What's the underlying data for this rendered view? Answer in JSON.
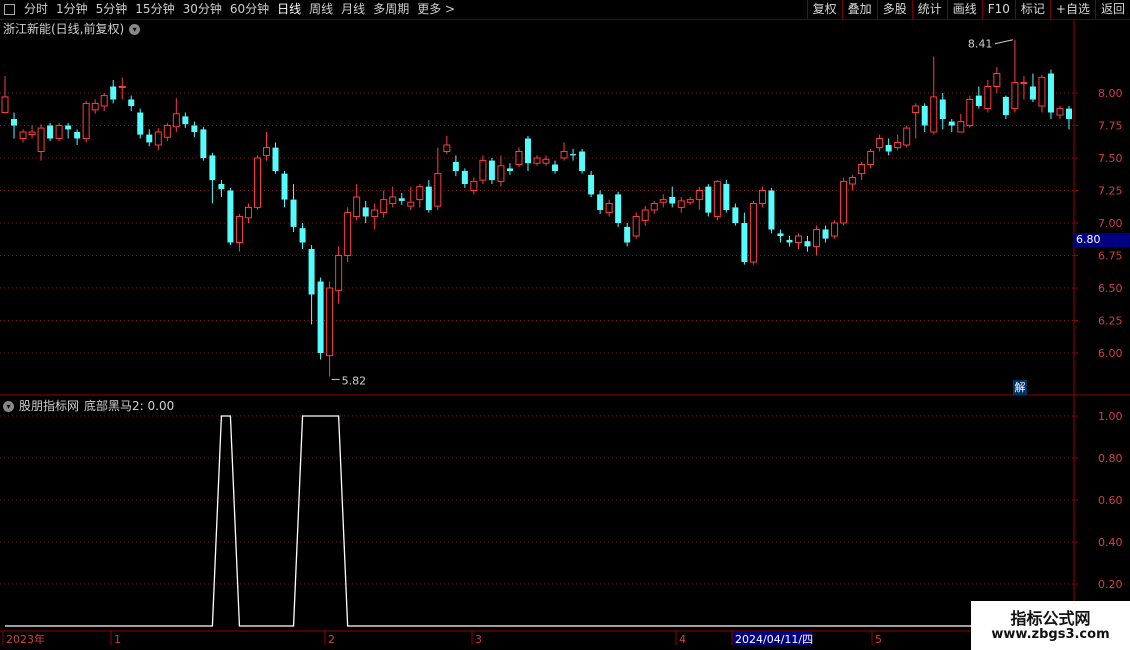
{
  "toolbar": {
    "periods": [
      "分时",
      "1分钟",
      "5分钟",
      "15分钟",
      "30分钟",
      "60分钟",
      "日线",
      "周线",
      "月线",
      "多周期",
      "更多 >"
    ],
    "active_period": "日线",
    "buttons": [
      "复权",
      "叠加",
      "多股",
      "统计",
      "画线",
      "F10",
      "标记",
      "+自选",
      "返回"
    ]
  },
  "main_chart": {
    "title": "浙江新能(日线,前复权)",
    "high_label": "8.41",
    "low_label": "5.82",
    "current_price": "6.80",
    "jie_label": "解",
    "y_ticks": [
      "8.00",
      "7.75",
      "7.50",
      "7.25",
      "7.00",
      "6.75",
      "6.50",
      "6.25",
      "6.00"
    ],
    "up_color": "#ff3c3c",
    "down_color": "#54fcfc"
  },
  "indicator": {
    "title": "股朋指标网",
    "label": "底部黑马2: 0.00",
    "y_ticks": [
      "1.00",
      "0.80",
      "0.60",
      "0.40",
      "0.20"
    ]
  },
  "x_axis": {
    "labels": [
      "2023年",
      "1",
      "2",
      "3",
      "4",
      "2024/04/11/四",
      "5"
    ]
  },
  "watermark": {
    "line1": "指标公式网",
    "line2": "www.zbgs3.com"
  },
  "chart_data": {
    "type": "candlestick",
    "candles": [
      [
        7.85,
        7.97,
        8.13,
        7.9
      ],
      [
        7.8,
        7.75,
        7.85,
        7.65
      ],
      [
        7.65,
        7.7,
        7.72,
        7.62
      ],
      [
        7.68,
        7.7,
        7.75,
        7.65
      ],
      [
        7.55,
        7.73,
        7.76,
        7.48
      ],
      [
        7.75,
        7.65,
        7.77,
        7.63
      ],
      [
        7.65,
        7.75,
        7.77,
        7.63
      ],
      [
        7.75,
        7.72,
        7.77,
        7.65
      ],
      [
        7.7,
        7.65,
        7.72,
        7.6
      ],
      [
        7.65,
        7.92,
        7.94,
        7.62
      ],
      [
        7.87,
        7.92,
        7.95,
        7.84
      ],
      [
        7.9,
        7.98,
        8.0,
        7.86
      ],
      [
        8.05,
        7.95,
        8.1,
        7.92
      ],
      [
        8.05,
        8.05,
        8.12,
        7.95
      ],
      [
        7.95,
        7.9,
        7.98,
        7.86
      ],
      [
        7.85,
        7.68,
        7.88,
        7.65
      ],
      [
        7.68,
        7.62,
        7.72,
        7.59
      ],
      [
        7.6,
        7.7,
        7.73,
        7.56
      ],
      [
        7.66,
        7.75,
        7.77,
        7.63
      ],
      [
        7.74,
        7.84,
        7.96,
        7.7
      ],
      [
        7.82,
        7.76,
        7.85,
        7.73
      ],
      [
        7.75,
        7.7,
        7.78,
        7.66
      ],
      [
        7.72,
        7.5,
        7.74,
        7.48
      ],
      [
        7.52,
        7.33,
        7.54,
        7.15
      ],
      [
        7.3,
        7.26,
        7.33,
        7.2
      ],
      [
        7.25,
        6.85,
        7.27,
        6.83
      ],
      [
        6.85,
        7.05,
        7.07,
        6.78
      ],
      [
        7.04,
        7.12,
        7.15,
        7.0
      ],
      [
        7.12,
        7.5,
        7.52,
        7.1
      ],
      [
        7.52,
        7.58,
        7.7,
        7.48
      ],
      [
        7.58,
        7.4,
        7.62,
        7.38
      ],
      [
        7.38,
        7.18,
        7.4,
        7.12
      ],
      [
        7.18,
        6.97,
        7.3,
        6.93
      ],
      [
        6.96,
        6.85,
        7.0,
        6.8
      ],
      [
        6.8,
        6.45,
        6.83,
        6.22
      ],
      [
        6.55,
        6.0,
        6.58,
        5.95
      ],
      [
        5.98,
        6.5,
        6.55,
        5.82
      ],
      [
        6.48,
        6.75,
        6.82,
        6.38
      ],
      [
        6.75,
        7.08,
        7.12,
        6.7
      ],
      [
        7.05,
        7.2,
        7.3,
        7.02
      ],
      [
        7.12,
        7.05,
        7.17,
        7.0
      ],
      [
        7.05,
        7.1,
        7.15,
        6.95
      ],
      [
        7.08,
        7.18,
        7.25,
        7.04
      ],
      [
        7.15,
        7.2,
        7.28,
        7.12
      ],
      [
        7.19,
        7.17,
        7.23,
        7.14
      ],
      [
        7.13,
        7.16,
        7.28,
        7.1
      ],
      [
        7.18,
        7.28,
        7.3,
        7.12
      ],
      [
        7.28,
        7.1,
        7.33,
        7.08
      ],
      [
        7.13,
        7.38,
        7.58,
        7.1
      ],
      [
        7.55,
        7.6,
        7.67,
        7.53
      ],
      [
        7.47,
        7.4,
        7.52,
        7.36
      ],
      [
        7.4,
        7.3,
        7.42,
        7.27
      ],
      [
        7.25,
        7.32,
        7.35,
        7.22
      ],
      [
        7.33,
        7.48,
        7.52,
        7.3
      ],
      [
        7.48,
        7.33,
        7.5,
        7.3
      ],
      [
        7.32,
        7.44,
        7.52,
        7.28
      ],
      [
        7.42,
        7.4,
        7.46,
        7.37
      ],
      [
        7.45,
        7.55,
        7.58,
        7.43
      ],
      [
        7.65,
        7.46,
        7.67,
        7.4
      ],
      [
        7.46,
        7.5,
        7.52,
        7.44
      ],
      [
        7.46,
        7.49,
        7.52,
        7.44
      ],
      [
        7.45,
        7.4,
        7.48,
        7.38
      ],
      [
        7.5,
        7.55,
        7.62,
        7.48
      ],
      [
        7.53,
        7.52,
        7.57,
        7.48
      ],
      [
        7.55,
        7.4,
        7.57,
        7.38
      ],
      [
        7.37,
        7.22,
        7.4,
        7.2
      ],
      [
        7.22,
        7.1,
        7.25,
        7.07
      ],
      [
        7.08,
        7.15,
        7.18,
        7.05
      ],
      [
        7.22,
        7.0,
        7.24,
        6.97
      ],
      [
        6.97,
        6.85,
        7.0,
        6.82
      ],
      [
        6.9,
        7.05,
        7.08,
        6.88
      ],
      [
        7.02,
        7.1,
        7.13,
        6.98
      ],
      [
        7.1,
        7.15,
        7.17,
        7.07
      ],
      [
        7.16,
        7.18,
        7.22,
        7.12
      ],
      [
        7.2,
        7.15,
        7.28,
        7.12
      ],
      [
        7.12,
        7.17,
        7.2,
        7.08
      ],
      [
        7.16,
        7.18,
        7.2,
        7.14
      ],
      [
        7.18,
        7.25,
        7.28,
        7.1
      ],
      [
        7.28,
        7.08,
        7.3,
        7.05
      ],
      [
        7.05,
        7.32,
        7.33,
        7.02
      ],
      [
        7.3,
        7.1,
        7.33,
        7.08
      ],
      [
        7.12,
        7.0,
        7.15,
        6.98
      ],
      [
        7.0,
        6.7,
        7.08,
        6.68
      ],
      [
        6.7,
        7.15,
        7.17,
        6.68
      ],
      [
        7.15,
        7.25,
        7.28,
        7.12
      ],
      [
        7.25,
        6.95,
        7.27,
        6.92
      ],
      [
        6.92,
        6.9,
        6.95,
        6.85
      ],
      [
        6.87,
        6.85,
        6.9,
        6.82
      ],
      [
        6.85,
        6.9,
        6.92,
        6.8
      ],
      [
        6.86,
        6.82,
        6.9,
        6.78
      ],
      [
        6.82,
        6.95,
        6.98,
        6.75
      ],
      [
        6.95,
        6.88,
        6.98,
        6.85
      ],
      [
        6.9,
        7.0,
        7.02,
        6.88
      ],
      [
        7.0,
        7.32,
        7.35,
        6.98
      ],
      [
        7.3,
        7.35,
        7.37,
        7.25
      ],
      [
        7.38,
        7.45,
        7.47,
        7.33
      ],
      [
        7.45,
        7.55,
        7.57,
        7.42
      ],
      [
        7.58,
        7.65,
        7.68,
        7.55
      ],
      [
        7.6,
        7.55,
        7.65,
        7.52
      ],
      [
        7.58,
        7.62,
        7.68,
        7.56
      ],
      [
        7.6,
        7.73,
        7.75,
        7.58
      ],
      [
        7.85,
        7.9,
        7.92,
        7.65
      ],
      [
        7.9,
        7.75,
        7.92,
        7.7
      ],
      [
        7.7,
        7.97,
        8.28,
        7.68
      ],
      [
        7.95,
        7.8,
        8.0,
        7.72
      ],
      [
        7.78,
        7.75,
        7.8,
        7.7
      ],
      [
        7.7,
        7.78,
        7.84,
        7.7
      ],
      [
        7.75,
        7.95,
        7.98,
        7.73
      ],
      [
        7.98,
        7.9,
        8.05,
        7.88
      ],
      [
        7.88,
        8.05,
        8.1,
        7.85
      ],
      [
        8.05,
        8.15,
        8.2,
        8.0
      ],
      [
        7.97,
        7.83,
        7.98,
        7.8
      ],
      [
        7.88,
        8.08,
        8.41,
        7.85
      ],
      [
        8.08,
        8.08,
        8.13,
        7.95
      ],
      [
        8.05,
        7.95,
        8.15,
        7.93
      ],
      [
        7.9,
        8.12,
        8.14,
        7.85
      ],
      [
        8.15,
        7.85,
        8.18,
        7.8
      ],
      [
        7.83,
        7.88,
        7.9,
        7.8
      ],
      [
        7.88,
        7.8,
        7.9,
        7.72
      ]
    ],
    "indicator_series": [
      0,
      0,
      0,
      0,
      0,
      0,
      0,
      0,
      0,
      0,
      0,
      0,
      0,
      0,
      0,
      0,
      0,
      0,
      0,
      0,
      0,
      0,
      0,
      0,
      1,
      1,
      0,
      0,
      0,
      0,
      0,
      0,
      0,
      1,
      1,
      1,
      1,
      1,
      0,
      0,
      0,
      0,
      0,
      0,
      0,
      0,
      0,
      0,
      0,
      0,
      0,
      0,
      0,
      0,
      0,
      0,
      0,
      0,
      0,
      0,
      0,
      0,
      0,
      0,
      0,
      0,
      0,
      0,
      0,
      0,
      0,
      0,
      0,
      0,
      0,
      0,
      0,
      0,
      0,
      0,
      0,
      0,
      0,
      0,
      0,
      0,
      0,
      0,
      0,
      0,
      0,
      0,
      0,
      0,
      0,
      0,
      0,
      0,
      0,
      0,
      0,
      0,
      0,
      0,
      0,
      0,
      0,
      0,
      0,
      0,
      0,
      0,
      0,
      0,
      0,
      0,
      0,
      0,
      0,
      0,
      0,
      0,
      0
    ]
  }
}
